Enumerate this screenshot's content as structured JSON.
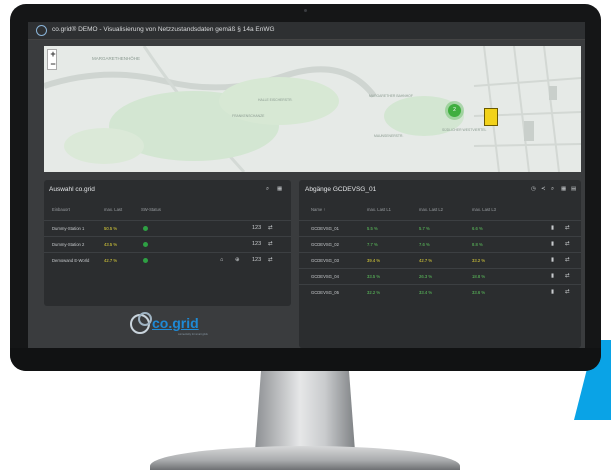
{
  "header": {
    "title": "co.grid® DEMO - Visualisierung von Netzzustandsdaten gemäß § 14a EnWG"
  },
  "map": {
    "zoom_in": "+",
    "zoom_out": "−",
    "labels": [
      "MARGARETHENHÖHE",
      "HALLE EISCHERSTR.",
      "FRANKENSCHANZE",
      "MARGARETHER BAHNHOF",
      "SÜDLICHER WESTVIERTEL",
      "MAUNSENERSTR."
    ],
    "cluster_count": "2"
  },
  "selection": {
    "title": "Auswahl co.grid",
    "columns": [
      "Einbauort",
      "max. Last",
      "SW-Status"
    ],
    "rows": [
      {
        "name": "Dummy-Station 1",
        "load": "50.5 %"
      },
      {
        "name": "Dummy-Station 2",
        "load": "43.5 %"
      },
      {
        "name": "Demowand E-World",
        "load": "42.7 %"
      }
    ]
  },
  "outlets": {
    "title": "Abgänge GCDEVSG_01",
    "columns": [
      "Name ↑",
      "max. Last L1",
      "max. Last L2",
      "max. Last L3"
    ],
    "rows": [
      {
        "name": "GCDEVSG_01",
        "l1": "5.5 %",
        "l2": "5.7 %",
        "l3": "6.6 %"
      },
      {
        "name": "GCDEVSG_02",
        "l1": "7.7 %",
        "l2": "7.6 %",
        "l3": "8.8 %"
      },
      {
        "name": "GCDEVSG_03",
        "l1": "39.4 %",
        "l2": "42.7 %",
        "l3": "33.2 %"
      },
      {
        "name": "GCDEVSG_04",
        "l1": "33.5 %",
        "l2": "26.3 %",
        "l3": "18.8 %"
      },
      {
        "name": "GCDEVSG_05",
        "l1": "32.2 %",
        "l2": "33.4 %",
        "l3": "33.6 %"
      }
    ]
  },
  "brand": {
    "logo_text": "co.grid",
    "tagline": "connectivity for smart grids"
  },
  "colors": {
    "accent": "#0aa3e6",
    "status_ok": "#2ea043",
    "load_high": "#e5d83a",
    "load_ok": "#5fc95f"
  }
}
